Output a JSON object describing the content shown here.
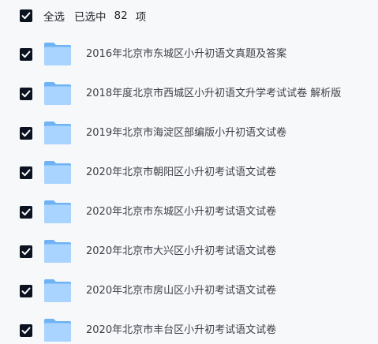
{
  "selection": {
    "label": "全选",
    "prefix": "已选中",
    "count": "82",
    "suffix": "项",
    "all_checked": true
  },
  "colors": {
    "checkbox": "#0b1320",
    "folder_light": "#a9d4ff",
    "folder_dark": "#6fb3f5",
    "text": "#3b3f45",
    "background": "#f7f8fa"
  },
  "files": [
    {
      "name": "2016年北京市东城区小升初语文真题及答案",
      "checked": true,
      "icon": "folder-icon"
    },
    {
      "name": "2018年度北京市西城区小升初语文升学考试试卷 解析版",
      "checked": true,
      "icon": "folder-icon"
    },
    {
      "name": "2019年北京市海淀区部编版小升初语文试卷",
      "checked": true,
      "icon": "folder-icon"
    },
    {
      "name": "2020年北京市朝阳区小升初考试语文试卷",
      "checked": true,
      "icon": "folder-icon"
    },
    {
      "name": "2020年北京市东城区小升初考试语文试卷",
      "checked": true,
      "icon": "folder-icon"
    },
    {
      "name": "2020年北京市大兴区小升初考试语文试卷",
      "checked": true,
      "icon": "folder-icon"
    },
    {
      "name": "2020年北京市房山区小升初考试语文试卷",
      "checked": true,
      "icon": "folder-icon"
    },
    {
      "name": "2020年北京市丰台区小升初考试语文试卷",
      "checked": true,
      "icon": "folder-icon"
    }
  ]
}
